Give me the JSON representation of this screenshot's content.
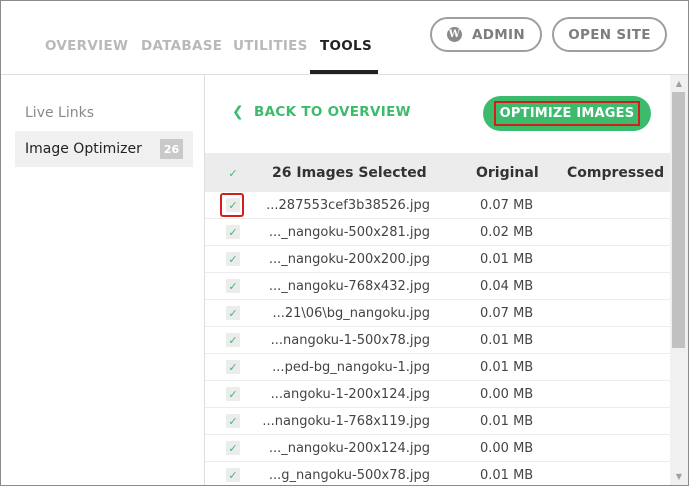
{
  "header": {
    "tabs": [
      {
        "label": "OVERVIEW"
      },
      {
        "label": "DATABASE"
      },
      {
        "label": "UTILITIES"
      },
      {
        "label": "TOOLS",
        "active": true
      }
    ],
    "admin_label": "ADMIN",
    "open_site_label": "OPEN SITE",
    "wp_icon_glyph": "W"
  },
  "sidebar": {
    "items": [
      {
        "label": "Live Links"
      },
      {
        "label": "Image Optimizer",
        "badge": "26",
        "active": true
      }
    ]
  },
  "main": {
    "back_label": "BACK TO OVERVIEW",
    "back_icon": "chevron-left-icon",
    "optimize_label": "OPTIMIZE IMAGES"
  },
  "table": {
    "headers": {
      "selected": "26 Images Selected",
      "original": "Original",
      "compressed": "Compressed"
    },
    "rows": [
      {
        "file": "...287553cef3b38526.jpg",
        "original": "0.07 MB",
        "checked": true
      },
      {
        "file": "..._nangoku-500x281.jpg",
        "original": "0.02 MB",
        "checked": true
      },
      {
        "file": "..._nangoku-200x200.jpg",
        "original": "0.01 MB",
        "checked": true
      },
      {
        "file": "..._nangoku-768x432.jpg",
        "original": "0.04 MB",
        "checked": true
      },
      {
        "file": "...21\\06\\bg_nangoku.jpg",
        "original": "0.07 MB",
        "checked": true
      },
      {
        "file": "...nangoku-1-500x78.jpg",
        "original": "0.01 MB",
        "checked": true
      },
      {
        "file": "...ped-bg_nangoku-1.jpg",
        "original": "0.01 MB",
        "checked": true
      },
      {
        "file": "...angoku-1-200x124.jpg",
        "original": "0.00 MB",
        "checked": true
      },
      {
        "file": "...nangoku-1-768x119.jpg",
        "original": "0.01 MB",
        "checked": true
      },
      {
        "file": "..._nangoku-200x124.jpg",
        "original": "0.00 MB",
        "checked": true
      },
      {
        "file": "...g_nangoku-500x78.jpg",
        "original": "0.01 MB",
        "checked": true
      }
    ]
  },
  "colors": {
    "accent": "#3dbb6d",
    "highlight": "#d0201a"
  }
}
